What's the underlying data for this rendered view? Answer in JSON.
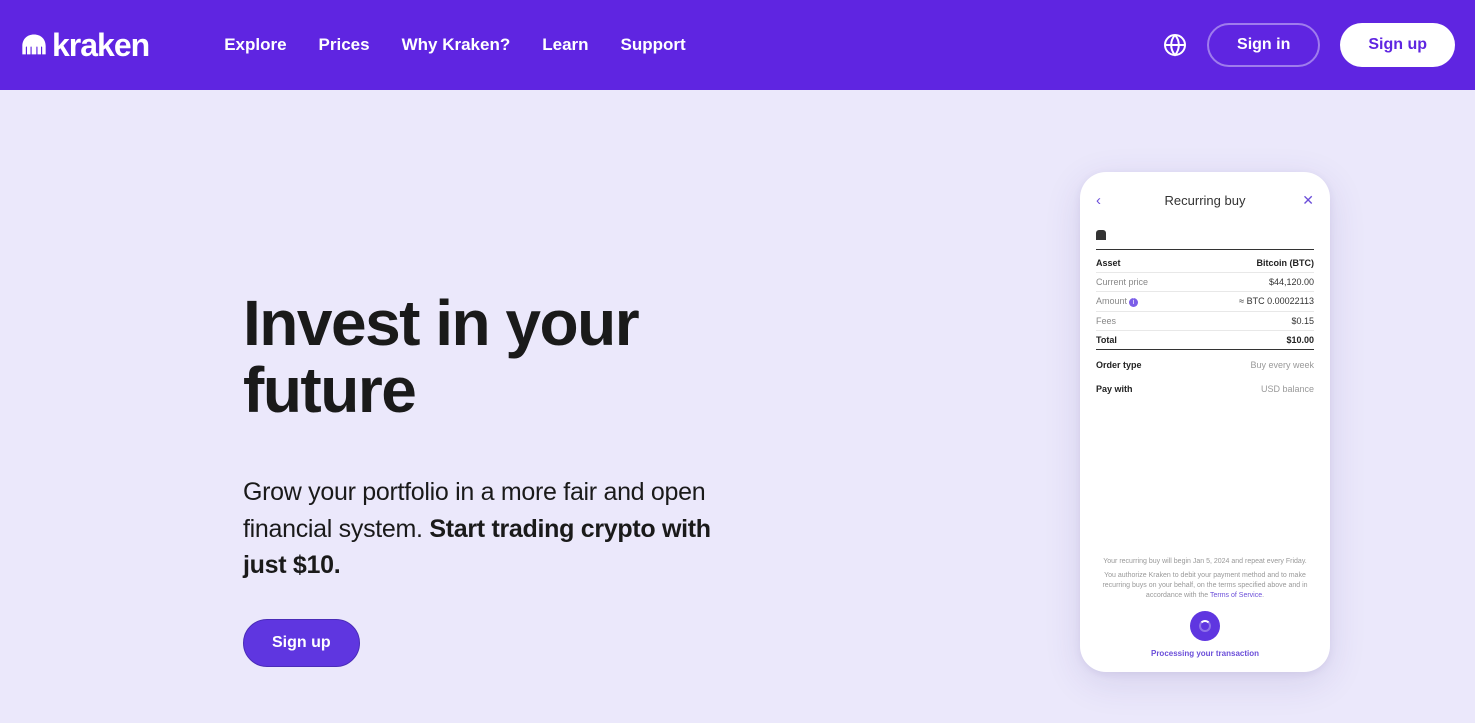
{
  "header": {
    "logo_text": "kraken",
    "nav": [
      "Explore",
      "Prices",
      "Why Kraken?",
      "Learn",
      "Support"
    ],
    "sign_in": "Sign in",
    "sign_up": "Sign up"
  },
  "hero": {
    "title": "Invest in your future",
    "subtitle_plain": "Grow your portfolio in a more fair and open financial system. ",
    "subtitle_bold": "Start trading crypto with just $10.",
    "cta": "Sign up"
  },
  "phone": {
    "title": "Recurring buy",
    "rows": {
      "asset": {
        "label": "Asset",
        "value": "Bitcoin (BTC)"
      },
      "price": {
        "label": "Current price",
        "value": "$44,120.00"
      },
      "amount": {
        "label": "Amount",
        "value": "≈ BTC 0.00022113"
      },
      "fees": {
        "label": "Fees",
        "value": "$0.15"
      },
      "total": {
        "label": "Total",
        "value": "$10.00"
      },
      "order_type": {
        "label": "Order type",
        "value": "Buy every week"
      },
      "pay_with": {
        "label": "Pay with",
        "value": "USD balance"
      }
    },
    "footer1": "Your recurring buy will begin Jan 5, 2024 and repeat every Friday.",
    "footer2_a": "You authorize Kraken to debit your payment method and to make recurring buys on your behalf, on the terms specified above and in accordance with the ",
    "footer2_link": "Terms of Service",
    "footer2_b": ".",
    "processing": "Processing your transaction"
  }
}
